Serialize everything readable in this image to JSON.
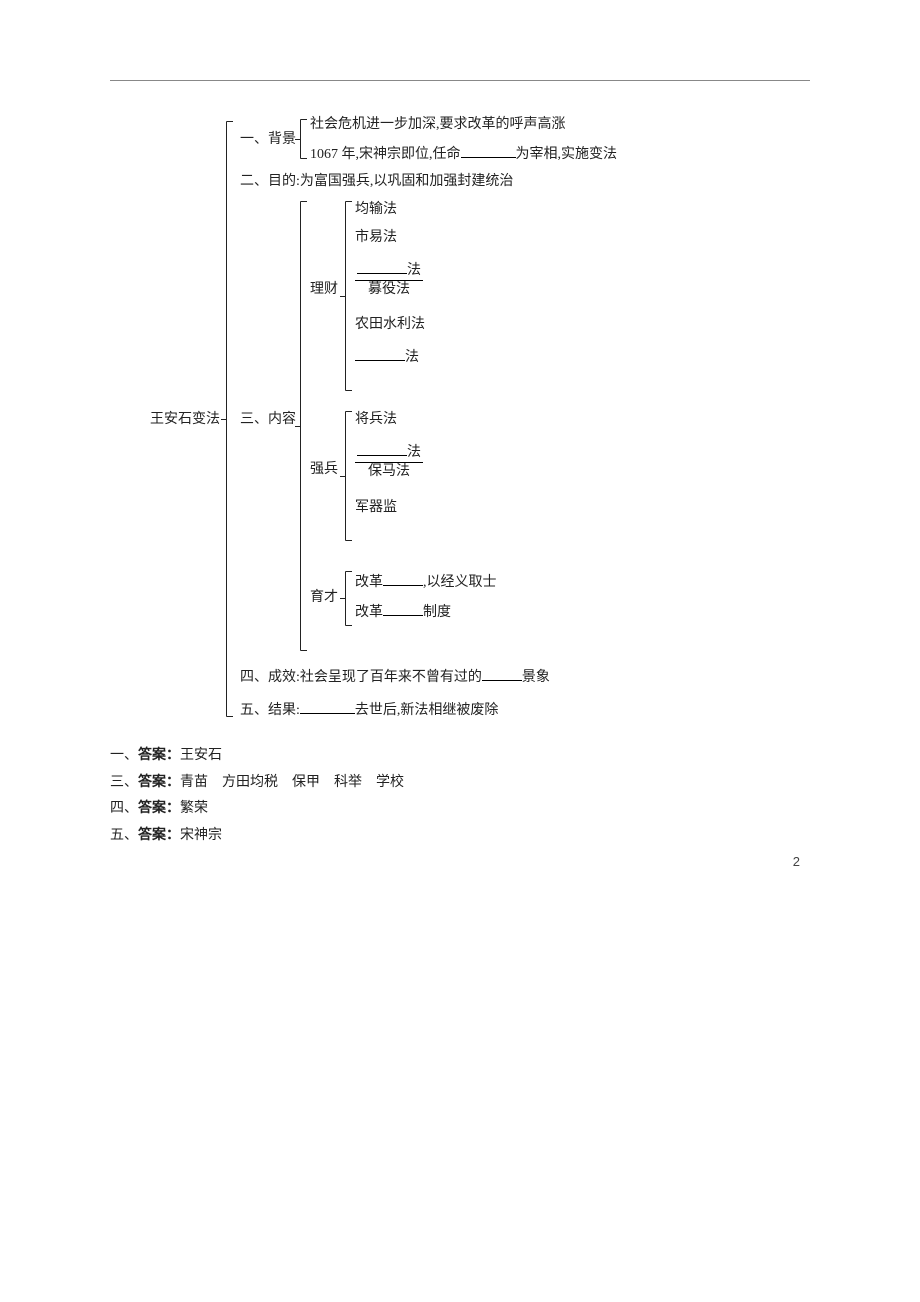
{
  "root_label": "王安石变法",
  "sec1": {
    "head": "一、背景",
    "line1": "社会危机进一步加深,要求改革的呼声高涨",
    "line2a": "1067 年,宋神宗即位,任命",
    "line2b": "为宰相,实施变法"
  },
  "sec2": "二、目的:为富国强兵,以巩固和加强封建统治",
  "sec3": {
    "head": "三、内容",
    "licai": {
      "head": "理财",
      "i1": "均输法",
      "i2": "市易法",
      "i3_suffix": "法",
      "frac_top_blank_suffix": "法",
      "frac_bot": "募役法",
      "i5": "农田水利法",
      "i6_suffix": "法"
    },
    "qiangbing": {
      "head": "强兵",
      "i1": "将兵法",
      "frac_top_blank_suffix": "法",
      "frac_bot": "保马法",
      "i4": "军器监"
    },
    "yucai": {
      "head": "育才",
      "l1a": "改革",
      "l1b": ",以经义取士",
      "l2a": "改革",
      "l2b": "制度"
    }
  },
  "sec4a": "四、成效:社会呈现了百年来不曾有过的",
  "sec4b": "景象",
  "sec5a": "五、结果:",
  "sec5b": "去世后,新法相继被废除",
  "answers": {
    "a1_label": "一、",
    "a1_bold": "答案：",
    "a1_val": "王安石",
    "a3_label": "三、",
    "a3_bold": "答案：",
    "a3_val": "青苗　方田均税　保甲　科举　学校",
    "a4_label": "四、",
    "a4_bold": "答案：",
    "a4_val": "繁荣",
    "a5_label": "五、",
    "a5_bold": "答案：",
    "a5_val": "宋神宗"
  },
  "page_number": "2"
}
